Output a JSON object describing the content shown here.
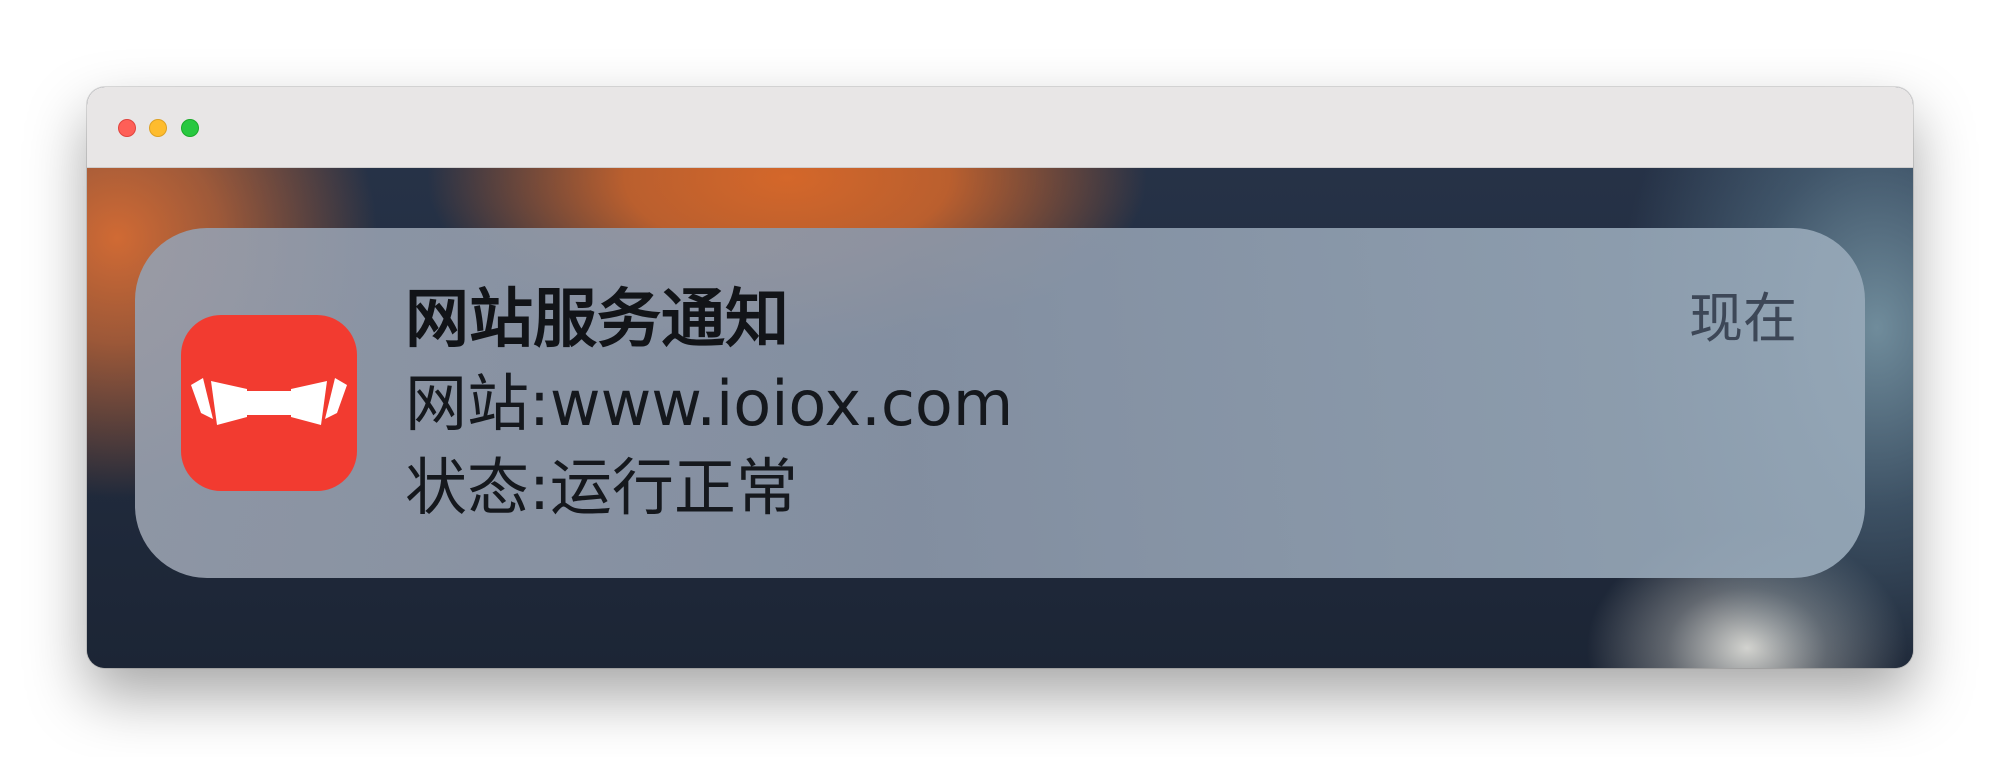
{
  "window": {
    "controls": [
      "close",
      "minimize",
      "zoom"
    ]
  },
  "notification": {
    "app_icon": "bowtie-app-icon",
    "title": "网站服务通知",
    "body_line1": "网站:www.ioiox.com",
    "body_line2": "状态:运行正常",
    "time": "现在"
  },
  "colors": {
    "icon_background": "#f23b30",
    "titlebar": "#e8e6e6",
    "close": "#fe5f57",
    "minimize": "#febc2e",
    "zoom": "#28c840"
  }
}
